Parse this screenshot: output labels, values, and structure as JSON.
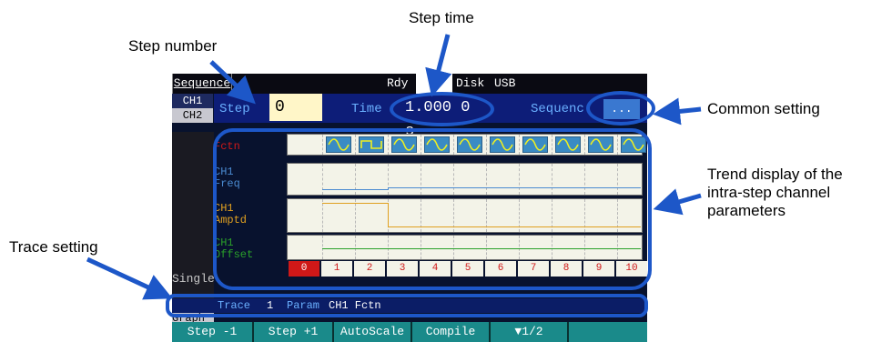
{
  "annotations": {
    "step_time": "Step time",
    "step_number": "Step number",
    "common_setting": "Common setting",
    "trend_display": [
      "Trend display of the",
      "intra-step channel",
      "parameters"
    ],
    "trace_setting": "Trace setting"
  },
  "topbar": {
    "mode_tab": "Sequence",
    "status_rdy": "Rdy",
    "status_disk": "Disk",
    "status_usb": "USB"
  },
  "channels": [
    "CH1",
    "CH2"
  ],
  "step": {
    "label": "Step",
    "value": "0"
  },
  "time": {
    "label": "Time",
    "value": "1.000 0 s"
  },
  "sequence": {
    "label": "Sequenc",
    "button": "..."
  },
  "rows": [
    {
      "label": "Fctn",
      "color": "#d01818"
    },
    {
      "label": "CH1\nFreq",
      "color": "#4a8ad0"
    },
    {
      "label": "CH1\nAmptd",
      "color": "#e0a020"
    },
    {
      "label": "CH1\nOffset",
      "color": "#2aa02a"
    }
  ],
  "step_axis": [
    "0",
    "1",
    "2",
    "3",
    "4",
    "5",
    "6",
    "7",
    "8",
    "9",
    "10"
  ],
  "side_labels": {
    "single": "Single",
    "graph": "Graph"
  },
  "trace_bar": {
    "trace_label": "Trace",
    "trace_value": "1",
    "param_label": "Param",
    "param_value": "CH1 Fctn"
  },
  "function_keys": [
    "Step -1",
    "Step +1",
    "AutoScale",
    "Compile",
    "▼1/2"
  ],
  "colors": {
    "accent": "#1d57c8",
    "screen_bg": "#08122e",
    "fkey": "#1a8a8a",
    "plot_bg": "#f3f3e8"
  }
}
